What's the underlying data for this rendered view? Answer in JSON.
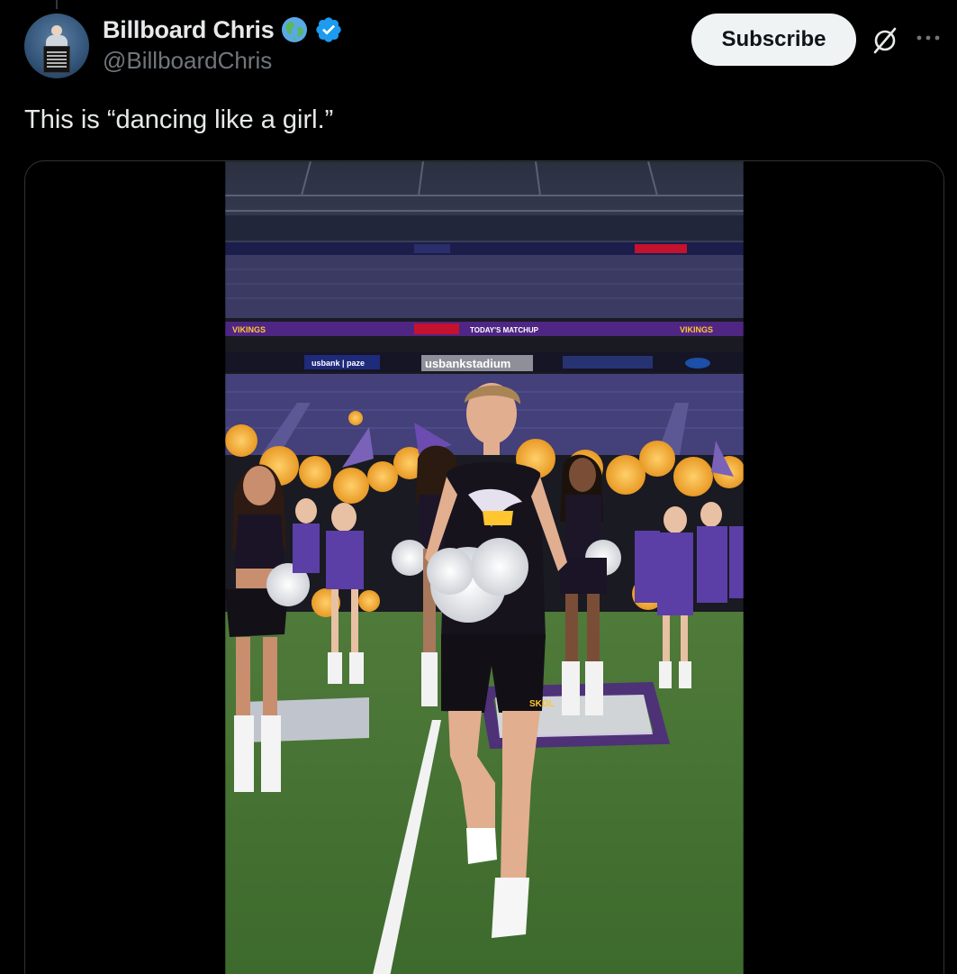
{
  "author": {
    "display_name": "Billboard Chris",
    "handle": "@BillboardChris",
    "avatar_icon": "avatar-with-sign",
    "badges": [
      "globe-icon",
      "verified-icon"
    ]
  },
  "actions": {
    "subscribe_label": "Subscribe",
    "grok_icon": "grok-icon",
    "more_icon": "more-icon"
  },
  "tweet": {
    "text": "This is “dancing like a girl.”"
  },
  "media": {
    "type": "video",
    "stadium_sign": "usbankstadium",
    "ribbon_labels": [
      "VIKINGS",
      "TODAY'S MATCHUP",
      "VIKINGS"
    ],
    "sponsor_sign": "usbank | paze",
    "jersey_text": "SKOL"
  },
  "colors": {
    "background": "#000000",
    "text_primary": "#e7e9ea",
    "text_secondary": "#71767b",
    "verified_blue": "#1d9bf0",
    "vikings_purple": "#4f2683",
    "vikings_gold": "#ffc62f",
    "card_border": "#2f3336"
  }
}
